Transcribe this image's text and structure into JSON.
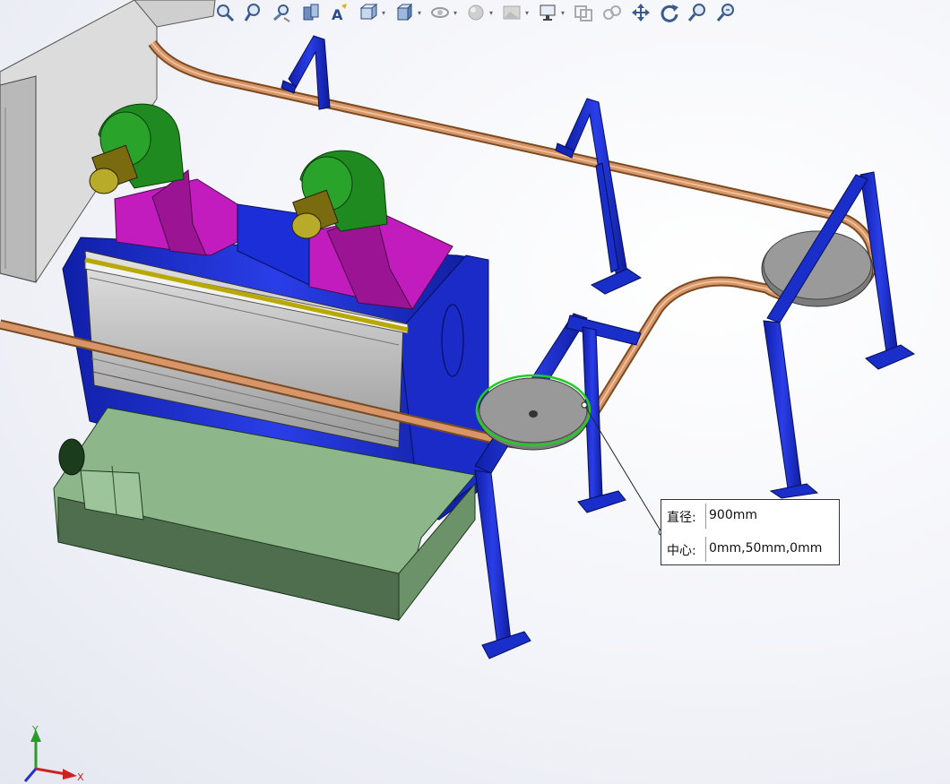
{
  "viewport": {
    "background": "#eef0f6"
  },
  "toolbar": {
    "items": [
      {
        "name": "zoom-to-fit-icon",
        "dropdown": false
      },
      {
        "name": "zoom-to-area-icon",
        "dropdown": false
      },
      {
        "name": "previous-view-icon",
        "dropdown": false
      },
      {
        "name": "section-view-icon",
        "dropdown": false
      },
      {
        "name": "dynamic-annotation-icon",
        "dropdown": false
      },
      {
        "name": "view-orientation-icon",
        "dropdown": true
      },
      {
        "name": "display-style-icon",
        "dropdown": true
      },
      {
        "name": "hide-show-items-icon",
        "dropdown": true
      },
      {
        "name": "edit-appearance-icon",
        "dropdown": true
      },
      {
        "name": "apply-scene-icon",
        "dropdown": true
      },
      {
        "name": "view-settings-icon",
        "dropdown": true
      },
      {
        "name": "screen-capture-icon",
        "dropdown": false
      },
      {
        "name": "link-icon",
        "dropdown": false
      },
      {
        "name": "pan-icon",
        "dropdown": false
      },
      {
        "name": "rotate-icon",
        "dropdown": false
      },
      {
        "name": "zoom-in-out-icon",
        "dropdown": false
      },
      {
        "name": "zoom-area-icon",
        "dropdown": false
      }
    ]
  },
  "measure": {
    "diameter_label": "直径:",
    "diameter_value": "900mm",
    "center_label": "中心:",
    "center_value": "0mm,50mm,0mm"
  },
  "triad": {
    "x_label": "X",
    "y_label": "Y"
  },
  "colors": {
    "frame_blue": "#1f2fd0",
    "conveyor_copper": "#c98a5a",
    "fan_green": "#1f8a1f",
    "duct_magenta": "#c21cbf",
    "tank_green": "#8db78b",
    "selection_green": "#22cc22"
  }
}
